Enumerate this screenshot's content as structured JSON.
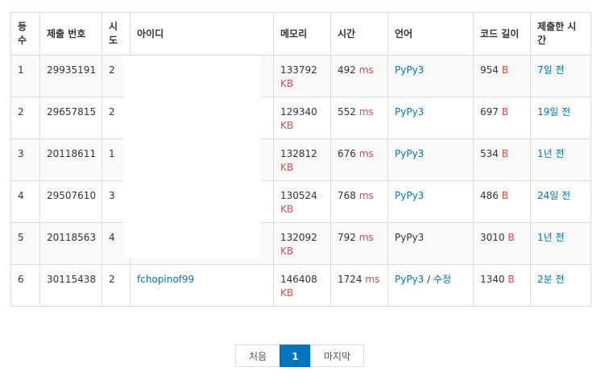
{
  "table": {
    "headers": [
      "등수",
      "제출 번호",
      "시도",
      "아이디",
      "메모리",
      "시간",
      "언어",
      "코드 길이",
      "제출한 시간"
    ],
    "header_display": [
      "등\n수",
      "제출 번호",
      "시\n도",
      "아이디",
      "메모리",
      "시간",
      "언어",
      "코드 길이",
      "제출한 시\n간"
    ],
    "rows": [
      {
        "rank": "1",
        "submission": "29935191",
        "tries": "2",
        "user": "",
        "memory": "133792",
        "time": "492",
        "lang": "PyPy3",
        "lang_link": true,
        "edit": "",
        "code_len": "954",
        "submitted": "7일 전"
      },
      {
        "rank": "2",
        "submission": "29657815",
        "tries": "2",
        "user": "",
        "memory": "129340",
        "time": "552",
        "lang": "PyPy3",
        "lang_link": true,
        "edit": "",
        "code_len": "697",
        "submitted": "19일 전"
      },
      {
        "rank": "3",
        "submission": "20118611",
        "tries": "1",
        "user": "",
        "memory": "132812",
        "time": "676",
        "lang": "PyPy3",
        "lang_link": true,
        "edit": "",
        "code_len": "534",
        "submitted": "1년 전"
      },
      {
        "rank": "4",
        "submission": "29507610",
        "tries": "3",
        "user": "",
        "memory": "130524",
        "time": "768",
        "lang": "PyPy3",
        "lang_link": true,
        "edit": "",
        "code_len": "486",
        "submitted": "24일 전"
      },
      {
        "rank": "5",
        "submission": "20118563",
        "tries": "4",
        "user": "",
        "memory": "132092",
        "time": "792",
        "lang": "PyPy3",
        "lang_link": false,
        "edit": "",
        "code_len": "3010",
        "submitted": "1년 전"
      },
      {
        "rank": "6",
        "submission": "30115438",
        "tries": "2",
        "user": "fchopinof99",
        "memory": "146408",
        "time": "1724",
        "lang": "PyPy3",
        "lang_link": true,
        "edit": "수정",
        "code_len": "1340",
        "submitted": "2분 전"
      }
    ],
    "units": {
      "memory": "KB",
      "time": "ms",
      "code_len": "B"
    }
  },
  "pagination": {
    "first": "처음",
    "current": "1",
    "last": "마지막"
  },
  "colors": {
    "link": "#0076c0",
    "unit": "#e74c3c",
    "border": "#dddddd",
    "stripe": "#f9f9f9"
  }
}
